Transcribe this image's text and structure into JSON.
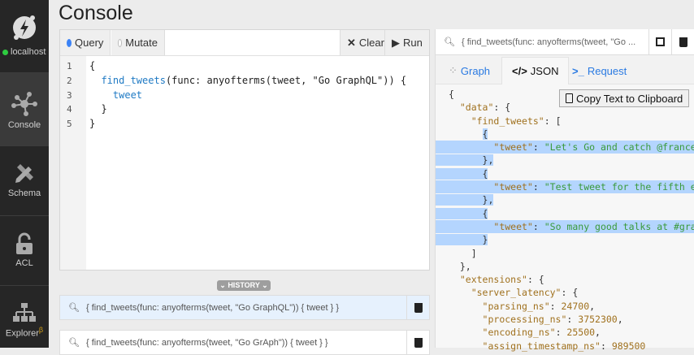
{
  "sidebar": {
    "host": "localhost",
    "items": [
      {
        "label": "Console"
      },
      {
        "label": "Schema"
      },
      {
        "label": "ACL"
      },
      {
        "label": "Explorer",
        "badge": "β"
      }
    ]
  },
  "page": {
    "title": "Console"
  },
  "editor": {
    "query_label": "Query",
    "mutate_label": "Mutate",
    "clear_label": "Clear",
    "run_label": "Run",
    "mode": "Query",
    "lines": [
      {
        "n": "1",
        "text": "{"
      },
      {
        "n": "2",
        "pre": "  ",
        "kw": "find_tweets",
        "text": "(func: anyofterms(tweet, \"Go GraphQL\")) {"
      },
      {
        "n": "3",
        "pre": "    ",
        "kw": "tweet",
        "text": ""
      },
      {
        "n": "4",
        "text": "  }"
      },
      {
        "n": "5",
        "text": "}"
      }
    ]
  },
  "history": {
    "label": "HISTORY",
    "items": [
      {
        "query": "{ find_tweets(func: anyofterms(tweet, \"Go GraphQL\")) { tweet } }"
      },
      {
        "query": "{ find_tweets(func: anyofterms(tweet, \"Go GrAph\")) { tweet } }"
      }
    ]
  },
  "result": {
    "search": "{ find_tweets(func: anyofterms(tweet, \"Go ...",
    "tabs": [
      {
        "label": "Graph"
      },
      {
        "label": "JSON"
      },
      {
        "label": "Request"
      }
    ],
    "active_tab": "JSON",
    "copy_label": "Copy Text to Clipboard",
    "tweets": [
      "Let's Go and catch @francesc",
      "Test tweet for the fifth epis",
      "So many good talks at #graphq"
    ],
    "latency": {
      "parsing_ns": "24700",
      "processing_ns": "3752300",
      "encoding_ns": "25500",
      "assign_timestamp_ns": "989500"
    }
  },
  "colors": {
    "accent": "#2a7ae2",
    "selection": "#b4d5fe",
    "status_online": "#2ecc40"
  }
}
